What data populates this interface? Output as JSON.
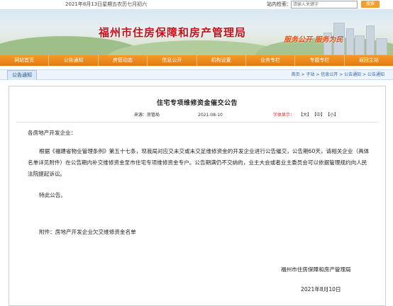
{
  "topbar": {
    "date_text": "2021年8月13日星期五农历七月初六",
    "search_label": "站内检索：",
    "search_placeholder": "请输入关键字",
    "search_button": "搜索"
  },
  "banner": {
    "site_title": "福州市住房保障和房产管理局",
    "slogan": "服务公开 服务为民"
  },
  "nav": {
    "items": [
      "网站首页",
      "公告通知",
      "房管动态",
      "信息公开",
      "机构设置",
      "业务专栏",
      "专题专栏",
      "返回主站"
    ]
  },
  "breadcrumb": {
    "tab_label": "公告通知",
    "path": "首页 > 子站 > 信息公开 > 公告通知 > 公告通知"
  },
  "article": {
    "title": "住宅专项维修资金催交公告",
    "source": "来源：房管局",
    "date": "2021-08-10",
    "font_size_label": "字体显示：",
    "font_options": [
      "【大】",
      "【中】",
      "【小】"
    ],
    "salutation": "各房地产开发企业：",
    "body": "根据《福建省物业管理条例》第五十七条，现我局对应交未交或未交足维修资金的开发企业进行公告催交，公告期60天，请相关企业（具体名单详见附件）在公告期内补交维修资金至市住宅专项维修资金专户。公告期满仍不交纳的，业主大会或者业主委员会可以依据管理规约向人民法院提起诉讼。",
    "special": "特此公告。",
    "attachment": "附件：房地产开发企业欠交维修资金名单",
    "signature_org": "福州市住房保障和房产管理局",
    "signature_date": "2021年8月10日"
  },
  "colors": {
    "nav_orange": "#e27a10",
    "title_red": "#c0101a",
    "link_blue": "#2a63a8",
    "font_label_red": "#e02020"
  }
}
